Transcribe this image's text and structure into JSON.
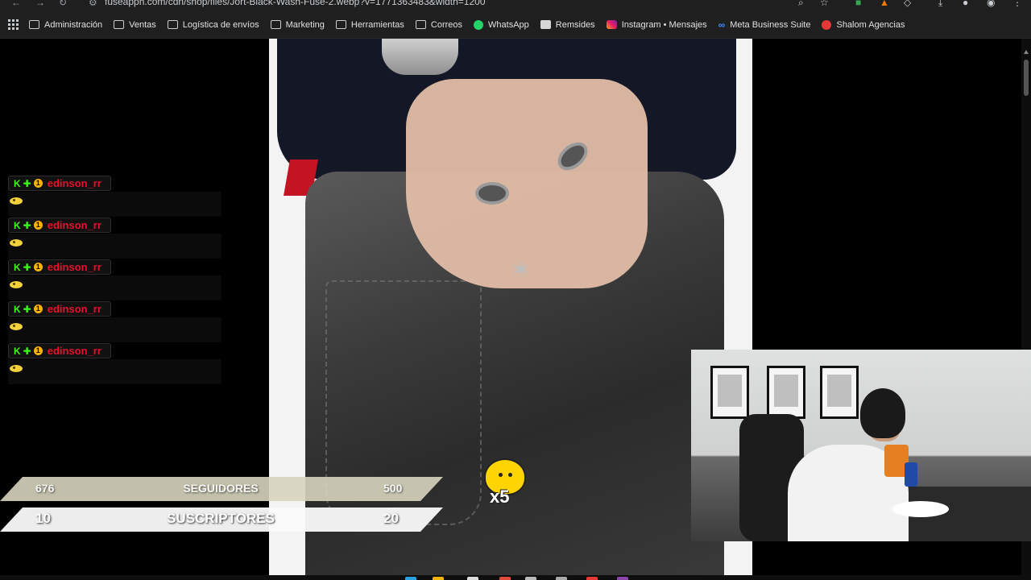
{
  "browser": {
    "url": "fuseapph.com/cdn/shop/files/Jort-Black-Wash-Fuse-2.webp?v=1771363483&width=1200",
    "bookmarks": [
      {
        "label": "Administración",
        "icon": "folder-icon"
      },
      {
        "label": "Ventas",
        "icon": "folder-icon"
      },
      {
        "label": "Logística de envíos",
        "icon": "folder-icon"
      },
      {
        "label": "Marketing",
        "icon": "folder-icon"
      },
      {
        "label": "Herramientas",
        "icon": "folder-icon"
      },
      {
        "label": "Correos",
        "icon": "folder-icon"
      },
      {
        "label": "WhatsApp",
        "icon": "whatsapp-icon"
      },
      {
        "label": "Remsides",
        "icon": "remsides-icon"
      },
      {
        "label": "Instagram • Mensajes",
        "icon": "instagram-icon"
      },
      {
        "label": "Meta Business Suite",
        "icon": "meta-icon"
      },
      {
        "label": "Shalom Agencias",
        "icon": "shalom-icon"
      }
    ]
  },
  "chat": {
    "messages": [
      {
        "user": "edinson_rr",
        "badges": [
          "K",
          "✚",
          "1"
        ]
      },
      {
        "user": "edinson_rr",
        "badges": [
          "K",
          "✚",
          "1"
        ]
      },
      {
        "user": "edinson_rr",
        "badges": [
          "K",
          "✚",
          "1"
        ]
      },
      {
        "user": "edinson_rr",
        "badges": [
          "K",
          "✚",
          "1"
        ]
      },
      {
        "user": "edinson_rr",
        "badges": [
          "K",
          "✚",
          "1"
        ]
      }
    ]
  },
  "goals": {
    "followers": {
      "current": "676",
      "label": "SEGUIDORES",
      "goal": "500"
    },
    "subscribers": {
      "current": "10",
      "label": "SUSCRIPTORES",
      "goal": "20"
    }
  },
  "mascot": {
    "multiplier": "x5"
  },
  "colors": {
    "username": "#e8102b",
    "badge_green": "#39ff14",
    "follow_bar": "#d7d5bd"
  }
}
